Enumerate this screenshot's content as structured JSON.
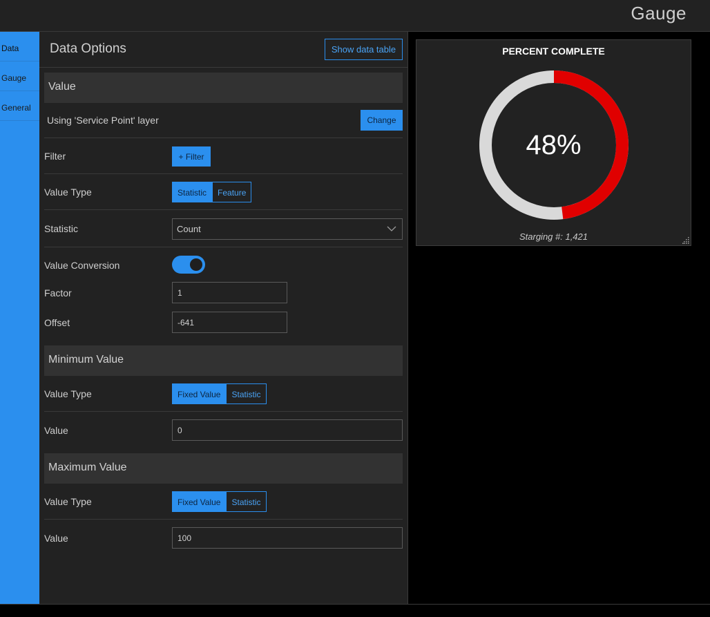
{
  "header": {
    "title": "Gauge"
  },
  "tabs": [
    {
      "label": "Data"
    },
    {
      "label": "Gauge"
    },
    {
      "label": "General"
    }
  ],
  "panel": {
    "title": "Data Options",
    "show_table_label": "Show data table",
    "value_section": {
      "title": "Value",
      "layer_text": "Using 'Service Point' layer",
      "change_label": "Change",
      "filter_label": "Filter",
      "filter_button": "+ Filter",
      "value_type_label": "Value Type",
      "value_type_options": [
        "Statistic",
        "Feature"
      ],
      "statistic_label": "Statistic",
      "statistic_value": "Count",
      "conversion_label": "Value Conversion",
      "conversion_on": true,
      "factor_label": "Factor",
      "factor_value": "1",
      "offset_label": "Offset",
      "offset_value": "-641"
    },
    "min_section": {
      "title": "Minimum Value",
      "value_type_label": "Value Type",
      "value_type_options": [
        "Fixed Value",
        "Statistic"
      ],
      "value_label": "Value",
      "value": "0"
    },
    "max_section": {
      "title": "Maximum Value",
      "value_type_label": "Value Type",
      "value_type_options": [
        "Fixed Value",
        "Statistic"
      ],
      "value_label": "Value",
      "value": "100"
    }
  },
  "gauge": {
    "title": "PERCENT COMPLETE",
    "value_text": "48%",
    "percent": 48,
    "footer": "Starging #: 1,421",
    "colors": {
      "filled": "#e00000",
      "empty": "#d9d9d9",
      "accent": "#2b8fee"
    }
  }
}
